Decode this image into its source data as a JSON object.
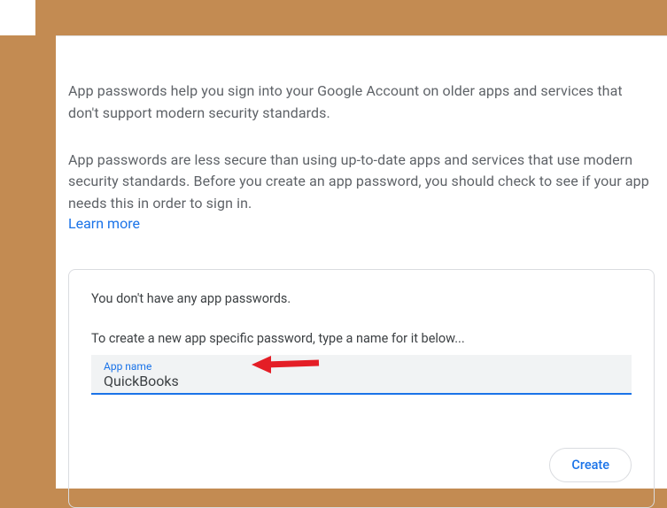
{
  "intro": {
    "paragraph1": "App passwords help you sign into your Google Account on older apps and services that don't support modern security standards.",
    "paragraph2": "App passwords are less secure than using up-to-date apps and services that use modern security standards. Before you create an app password, you should check to see if your app needs this in order to sign in.",
    "learn_more": "Learn more"
  },
  "card": {
    "no_passwords": "You don't have any app passwords.",
    "instruction": "To create a new app specific password, type a name for it below...",
    "input_label": "App name",
    "input_value": "QuickBooks",
    "create_label": "Create"
  }
}
